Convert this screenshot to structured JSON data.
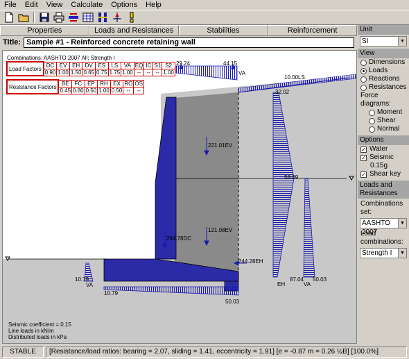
{
  "menu": [
    "File",
    "Edit",
    "View",
    "Calculate",
    "Options",
    "Help"
  ],
  "toolbar": {
    "icons": [
      "new-file-icon",
      "open-folder-icon",
      "save-icon",
      "print-icon",
      "wall-design-icon",
      "table-icon",
      "columns-icon",
      "axis-icon",
      "help-icon"
    ]
  },
  "tabs": [
    "Properties",
    "Loads and Resistances",
    "Stabilities",
    "Reinforcement"
  ],
  "title": {
    "label": "Title:",
    "value": "Sample #1 - Reinforced concrete retaining wall"
  },
  "canvas": {
    "combinations_text": "Combinations: AASHTO 2007 All; Strength I",
    "load_factors": {
      "label": "Load Factors",
      "headers": [
        "DC",
        "EV",
        "EH",
        "DV",
        "ES",
        "LS",
        "VA",
        "EQ",
        "IC",
        "S1",
        "S2"
      ],
      "values": [
        "0.90",
        "1.00",
        "1.50",
        "0.65",
        "0.75",
        "1.75",
        "1.00",
        "--",
        "--",
        "--",
        "1.00"
      ]
    },
    "resistance_factors": {
      "label": "Resistance Factors",
      "headers": [
        "BE",
        "FC",
        "EP",
        "RH",
        "EX",
        "RO",
        "OS"
      ],
      "values": [
        "0.45",
        "0.80",
        "0.50",
        "1.00",
        "0.50",
        "--",
        "--"
      ]
    },
    "load_labels": {
      "va_top_left": "29.24",
      "va_top_right": "44.15",
      "va_top": "VA",
      "ls": "10.00LS",
      "eh_top": "32.02",
      "eh_mid": "58.09",
      "eh_label": "EH",
      "eh_bottom": "87.04",
      "va_right_bottom": "50.03",
      "va_right": "VA",
      "ev_upper": "221.01EV",
      "ev_lower": "121.08EV",
      "dc": "294.78DC",
      "eh_force": "244.28EH",
      "va_left": "VA",
      "va_left_val": "10.79",
      "base_left": "10.79",
      "base_right": "50.03"
    },
    "notes": [
      "Seismic coefficient = 0.15",
      "Line loads in kN/m",
      "Distributed loads in kPa"
    ]
  },
  "sidepanel": {
    "unit_label": "Unit",
    "unit_value": "SI",
    "view_label": "View",
    "view_options": [
      {
        "label": "Dimensions",
        "selected": false
      },
      {
        "label": "Loads",
        "selected": true
      },
      {
        "label": "Reactions",
        "selected": false
      },
      {
        "label": "Resistances",
        "selected": false
      }
    ],
    "force_label": "Force diagrams:",
    "force_options": [
      {
        "label": "Moment",
        "selected": false
      },
      {
        "label": "Shear",
        "selected": false
      },
      {
        "label": "Normal",
        "selected": false
      }
    ],
    "options_label": "Options",
    "water": "Water",
    "seismic": "Seismic",
    "seismic_value": "0.15g",
    "shear_key": "Shear key",
    "loads_label": "Loads and Resistances",
    "comb_set_label": "Combinations set:",
    "comb_set_value": "AASHTO 2007",
    "load_comb_label": "Load combinations:",
    "load_comb_value": "Strength I"
  },
  "status": {
    "state": "STABLE",
    "message": "[Resistance/load ratios: bearing = 2.07, sliding = 1.41, eccentricity = 1.91] [e = -0.87 m = 0.26 ½B] [100.0%]"
  }
}
